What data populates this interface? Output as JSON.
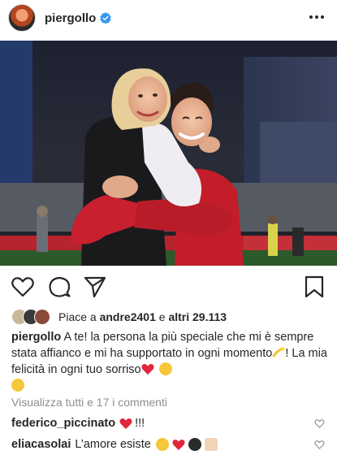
{
  "post": {
    "username": "piergollo",
    "verified": true,
    "likes": {
      "prefix": "Piace a ",
      "first_user": "andre2401",
      "and_label": " e ",
      "others": "altri 29.113"
    },
    "caption": {
      "user": "piergollo",
      "text_part1": " A te! la persona la più speciale che mi è sempre stata affianco e mi ha supportato in ogni momento",
      "text_part2": "! La mia felicità in ogni tuo sorriso"
    },
    "view_all_comments": "Visualizza tutti e 17 i commenti",
    "comments": [
      {
        "user": "federico_piccinato",
        "text": "!!!"
      },
      {
        "user": "eliacasolai",
        "text": "L’amore esiste"
      }
    ]
  },
  "icons": {
    "more": "more-horizontal-icon",
    "like": "heart-outline-icon",
    "comment": "comment-bubble-icon",
    "share": "paper-plane-icon",
    "save": "bookmark-icon"
  },
  "colors": {
    "text": "#262626",
    "muted": "#8e8e8e",
    "verified": "#3897f0",
    "heart_red": "#e0263a"
  }
}
